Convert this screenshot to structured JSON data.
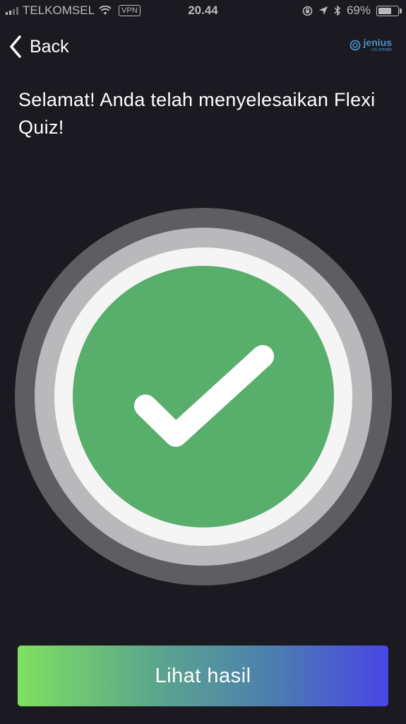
{
  "status_bar": {
    "carrier": "TELKOMSEL",
    "vpn": "VPN",
    "time": "20.44",
    "battery_percent": "69%",
    "battery_level": 0.69,
    "icons": [
      "signal-icon",
      "wifi-icon",
      "rotation-lock-icon",
      "location-icon",
      "bluetooth-icon",
      "battery-icon"
    ]
  },
  "nav": {
    "back_label": "Back",
    "brand_name": "jenius",
    "brand_sub": "co.create"
  },
  "main": {
    "title": "Selamat! Anda telah menyelesaikan Flexi Quiz!"
  },
  "success_graphic": {
    "icon": "checkmark-icon",
    "ring_colors": [
      "#5d5d62",
      "#b9b9bb",
      "#f5f5f5"
    ],
    "fill_color": "#58ae6b"
  },
  "action": {
    "result_label": "Lihat hasil"
  },
  "colors": {
    "background": "#1b1a20",
    "gradient_start": "#7fe05f",
    "gradient_end": "#4a46e6",
    "brand_blue": "#4a90c8"
  }
}
